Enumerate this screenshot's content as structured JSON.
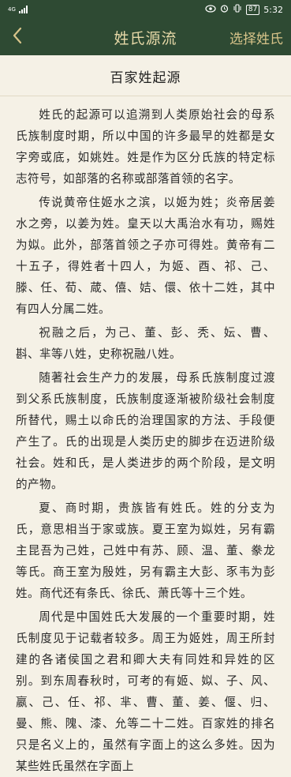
{
  "status": {
    "signal": "4G",
    "battery": "87",
    "time": "5:32"
  },
  "nav": {
    "title": "姓氏源流",
    "action_label": "选择姓氏"
  },
  "article": {
    "title": "百家姓起源",
    "paragraphs": [
      "姓氏的起源可以追溯到人类原始社会的母系氏族制度时期，所以中国的许多最早的姓都是女字旁或底，如姚姓。姓是作为区分氏族的特定标志符号，如部落的名称或部落首领的名字。",
      "传说黄帝住姬水之滨，以姬为姓；炎帝居姜水之旁，以姜为姓。皇天以大禹治水有功，赐姓为姒。此外，部落首领之子亦可得姓。黄帝有二十五子，得姓者十四人，为姬、酉、祁、己、滕、任、荀、葴、僖、姞、儇、依十二姓，其中有四人分属二姓。",
      "祝融之后，为己、董、彭、秃、妘、曹、斟、芈等八姓，史称祝融八姓。",
      "随著社会生产力的发展，母系氏族制度过渡到父系氏族制度，氏族制度逐渐被阶级社会制度所替代，赐土以命氏的治理国家的方法、手段便产生了。氏的出现是人类历史的脚步在迈进阶级社会。姓和氏，是人类进步的两个阶段，是文明的产物。",
      "夏、商时期，贵族皆有姓氏。姓的分支为氏，意思相当于家或族。夏王室为姒姓，另有霸主昆吾为己姓，己姓中有苏、顾、温、董、豢龙等氏。商王室为殷姓，另有霸主大彭、豕韦为彭姓。商代还有条氏、徐氏、萧氏等十三个姓。",
      "周代是中国姓氏大发展的一个重要时期，姓氏制度见于记载者较多。周王为姬姓，周王所封建的各诸侯国之君和卿大夫有同姓和异姓的区别。到东周春秋时，可考的有姬、姒、子、风、嬴、己、任、祁、芈、曹、董、姜、偃、归、曼、熊、隗、漆、允等二十二姓。百家姓的排名只是名义上的，虽然有字面上的这么多姓。因为某些姓氏虽然在字面上"
    ]
  }
}
